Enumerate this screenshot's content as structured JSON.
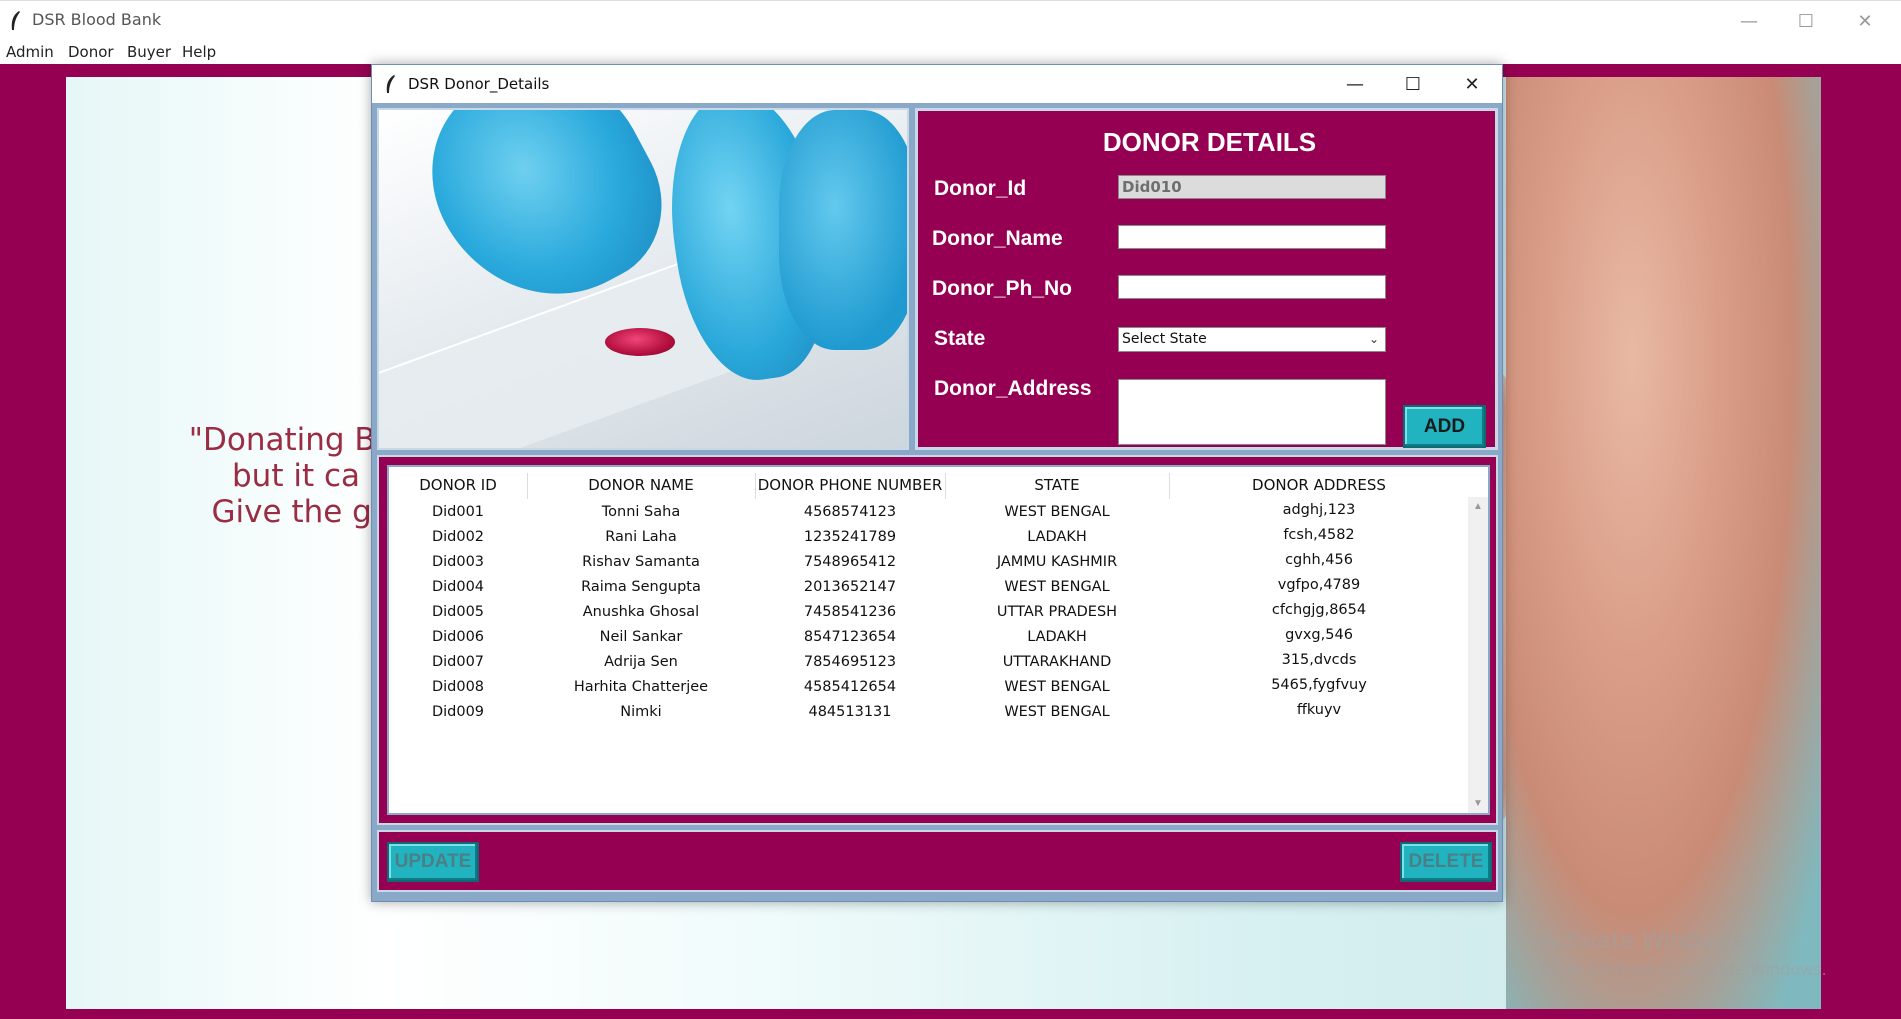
{
  "main_window": {
    "title": "DSR Blood Bank",
    "controls": {
      "minimize": "—",
      "maximize": "☐",
      "close": "✕"
    },
    "menu": [
      "Admin",
      "Donor",
      "Buyer",
      "Help"
    ],
    "quote_lines": [
      "\"Donating Blo",
      "but it ca",
      "Give the gi"
    ],
    "watermark_title": "Activate Windows",
    "watermark_sub": "Go to Settings to activate Windows."
  },
  "dialog": {
    "title": "DSR Donor_Details",
    "controls": {
      "minimize": "—",
      "maximize": "☐",
      "close": "✕"
    },
    "form": {
      "heading": "DONOR DETAILS",
      "donor_id_label": "Donor_Id",
      "donor_id_value": "Did010",
      "donor_name_label": "Donor_Name",
      "donor_name_value": "",
      "donor_phone_label": "Donor_Ph_No",
      "donor_phone_value": "",
      "state_label": "State",
      "state_value": "Select State",
      "address_label": "Donor_Address",
      "address_value": "",
      "add_button": "ADD"
    },
    "table": {
      "columns": [
        "DONOR ID",
        "DONOR NAME",
        "DONOR PHONE NUMBER",
        "STATE",
        "DONOR ADDRESS"
      ],
      "rows": [
        [
          "Did001",
          "Tonni Saha",
          "4568574123",
          "WEST BENGAL",
          "adghj,123"
        ],
        [
          "Did002",
          "Rani Laha",
          "1235241789",
          "LADAKH",
          "fcsh,4582"
        ],
        [
          "Did003",
          "Rishav Samanta",
          "7548965412",
          "JAMMU KASHMIR",
          "cghh,456"
        ],
        [
          "Did004",
          "Raima Sengupta",
          "2013652147",
          "WEST BENGAL",
          "vgfpo,4789"
        ],
        [
          "Did005",
          "Anushka Ghosal",
          "7458541236",
          "UTTAR PRADESH",
          "cfchgjg,8654"
        ],
        [
          "Did006",
          "Neil Sankar",
          "8547123654",
          "LADAKH",
          "gvxg,546"
        ],
        [
          "Did007",
          "Adrija Sen",
          "7854695123",
          "UTTARAKHAND",
          "315,dvcds"
        ],
        [
          "Did008",
          "Harhita Chatterjee",
          "4585412654",
          "WEST BENGAL",
          "5465,fygfvuy"
        ],
        [
          "Did009",
          "Nimki",
          "484513131",
          "WEST BENGAL",
          "ffkuyv"
        ]
      ]
    },
    "update_button": "UPDATE",
    "delete_button": "DELETE"
  },
  "colors": {
    "brand": "#950052",
    "button": "#21b4c0"
  }
}
